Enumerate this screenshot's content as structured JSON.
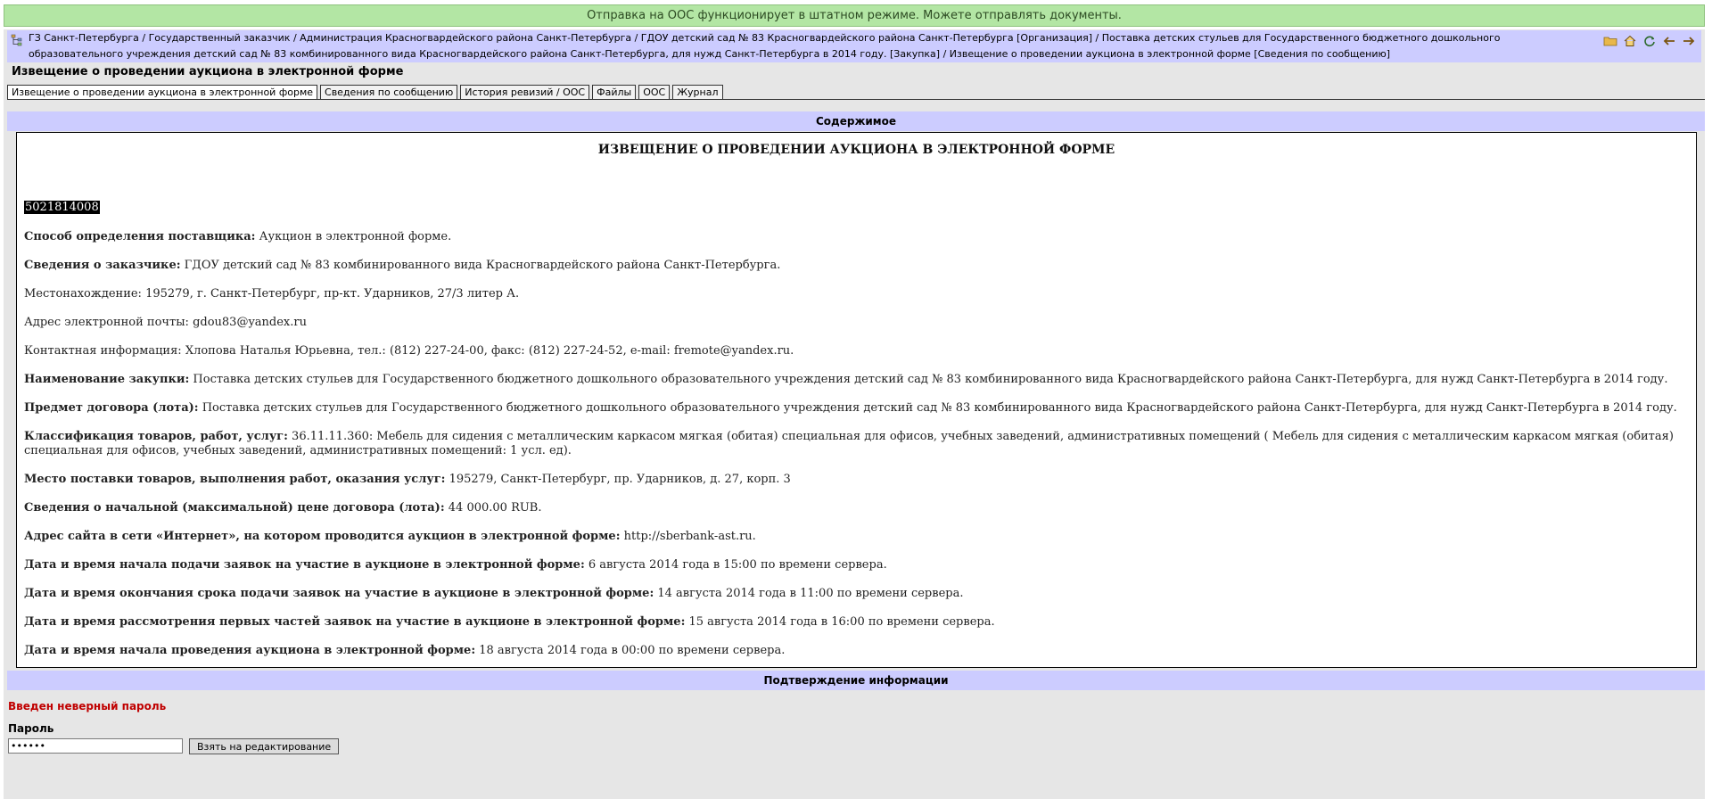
{
  "status_bar": {
    "text": "Отправка на ООС функционирует в штатном режиме. Можете отправлять документы."
  },
  "breadcrumb": {
    "text": "ГЗ Санкт-Петербурга / Государственный заказчик / Администрация Красногвардейского района Санкт-Петербурга / ГДОУ детский сад № 83 Красногвардейского района Санкт-Петербурга [Организация] / Поставка детских стульев для Государственного бюджетного дошкольного образовательного учреждения детский сад № 83 комбинированного вида Красногвардейского района Санкт-Петербурга, для нужд Санкт-Петербурга в 2014 году. [Закупка] / Извещение о проведении аукциона в электронной форме [Сведения по сообщению]"
  },
  "page_title": "Извещение о проведении аукциона в электронной форме",
  "tabs": [
    {
      "label": "Извещение о проведении аукциона в электронной форме"
    },
    {
      "label": "Сведения по сообщению"
    },
    {
      "label": "История ревизий / ООС"
    },
    {
      "label": "Файлы"
    },
    {
      "label": "ООС"
    },
    {
      "label": "Журнал"
    }
  ],
  "content": {
    "header": "Содержимое",
    "doc_title": "ИЗВЕЩЕНИЕ О ПРОВЕДЕНИИ АУКЦИОНА В ЭЛЕКТРОННОЙ ФОРМЕ",
    "reg_number": "5021814008",
    "fields": [
      {
        "label": "Способ определения поставщика:",
        "value": " Аукцион в электронной форме."
      },
      {
        "label": "Сведения о заказчике:",
        "value": " ГДОУ детский сад № 83 комбинированного вида Красногвардейского района Санкт-Петербурга."
      },
      {
        "label": "",
        "value": "Местонахождение: 195279, г. Санкт-Петербург, пр-кт. Ударников, 27/3 литер А."
      },
      {
        "label": "",
        "value": "Адрес электронной почты: gdou83@yandex.ru"
      },
      {
        "label": "",
        "value": "Контактная информация: Хлопова Наталья Юрьевна, тел.: (812) 227-24-00, факс: (812) 227-24-52, e-mail: fremote@yandex.ru."
      },
      {
        "label": "Наименование закупки:",
        "value": " Поставка детских стульев для Государственного бюджетного дошкольного образовательного учреждения детский сад № 83 комбинированного вида Красногвардейского района Санкт-Петербурга, для нужд Санкт-Петербурга в 2014 году."
      },
      {
        "label": "Предмет договора (лота):",
        "value": " Поставка детских стульев для Государственного бюджетного дошкольного образовательного учреждения детский сад № 83 комбинированного вида Красногвардейского района Санкт-Петербурга, для нужд Санкт-Петербурга в 2014 году."
      },
      {
        "label": "Классификация товаров, работ, услуг:",
        "value": " 36.11.11.360: Мебель для сидения с металлическим каркасом мягкая (обитая) специальная для офисов, учебных заведений, административных помещений ( Мебель для сидения с металлическим каркасом мягкая (обитая) специальная для офисов, учебных заведений, административных помещений: 1 усл. ед)."
      },
      {
        "label": "Место поставки товаров, выполнения работ, оказания услуг:",
        "value": " 195279, Санкт-Петербург, пр. Ударников, д. 27, корп. 3"
      },
      {
        "label": "Сведения о начальной (максимальной) цене договора (лота):",
        "value": " 44 000.00 RUB."
      },
      {
        "label": "Адрес сайта в сети «Интернет», на котором проводится аукцион в электронной форме:",
        "value": " http://sberbank-ast.ru."
      },
      {
        "label": "Дата и время начала подачи заявок на участие в аукционе в электронной форме:",
        "value": " 6 августа 2014 года в 15:00 по времени сервера."
      },
      {
        "label": "Дата и время окончания срока подачи заявок на участие в аукционе в электронной форме:",
        "value": " 14 августа 2014 года в 11:00 по времени сервера."
      },
      {
        "label": "Дата и время рассмотрения первых частей заявок на участие в аукционе в электронной форме:",
        "value": " 15 августа 2014 года в 16:00 по времени сервера."
      },
      {
        "label": "Дата и время начала проведения аукциона в электронной форме:",
        "value": " 18 августа 2014 года в 00:00 по времени сервера."
      }
    ]
  },
  "confirmation": {
    "header": "Подтверждение информации",
    "error": "Введен неверный пароль",
    "password_label": "Пароль",
    "password_value": "••••••",
    "edit_button": "Взять на редактирование"
  },
  "icons": {
    "app": "tree-structure-icon",
    "nav": [
      "folder-icon",
      "home-icon",
      "refresh-icon",
      "back-icon",
      "forward-icon"
    ]
  },
  "colors": {
    "status_bg": "#b3e6a4",
    "header_bg": "#ccccff",
    "error": "#c00000"
  }
}
